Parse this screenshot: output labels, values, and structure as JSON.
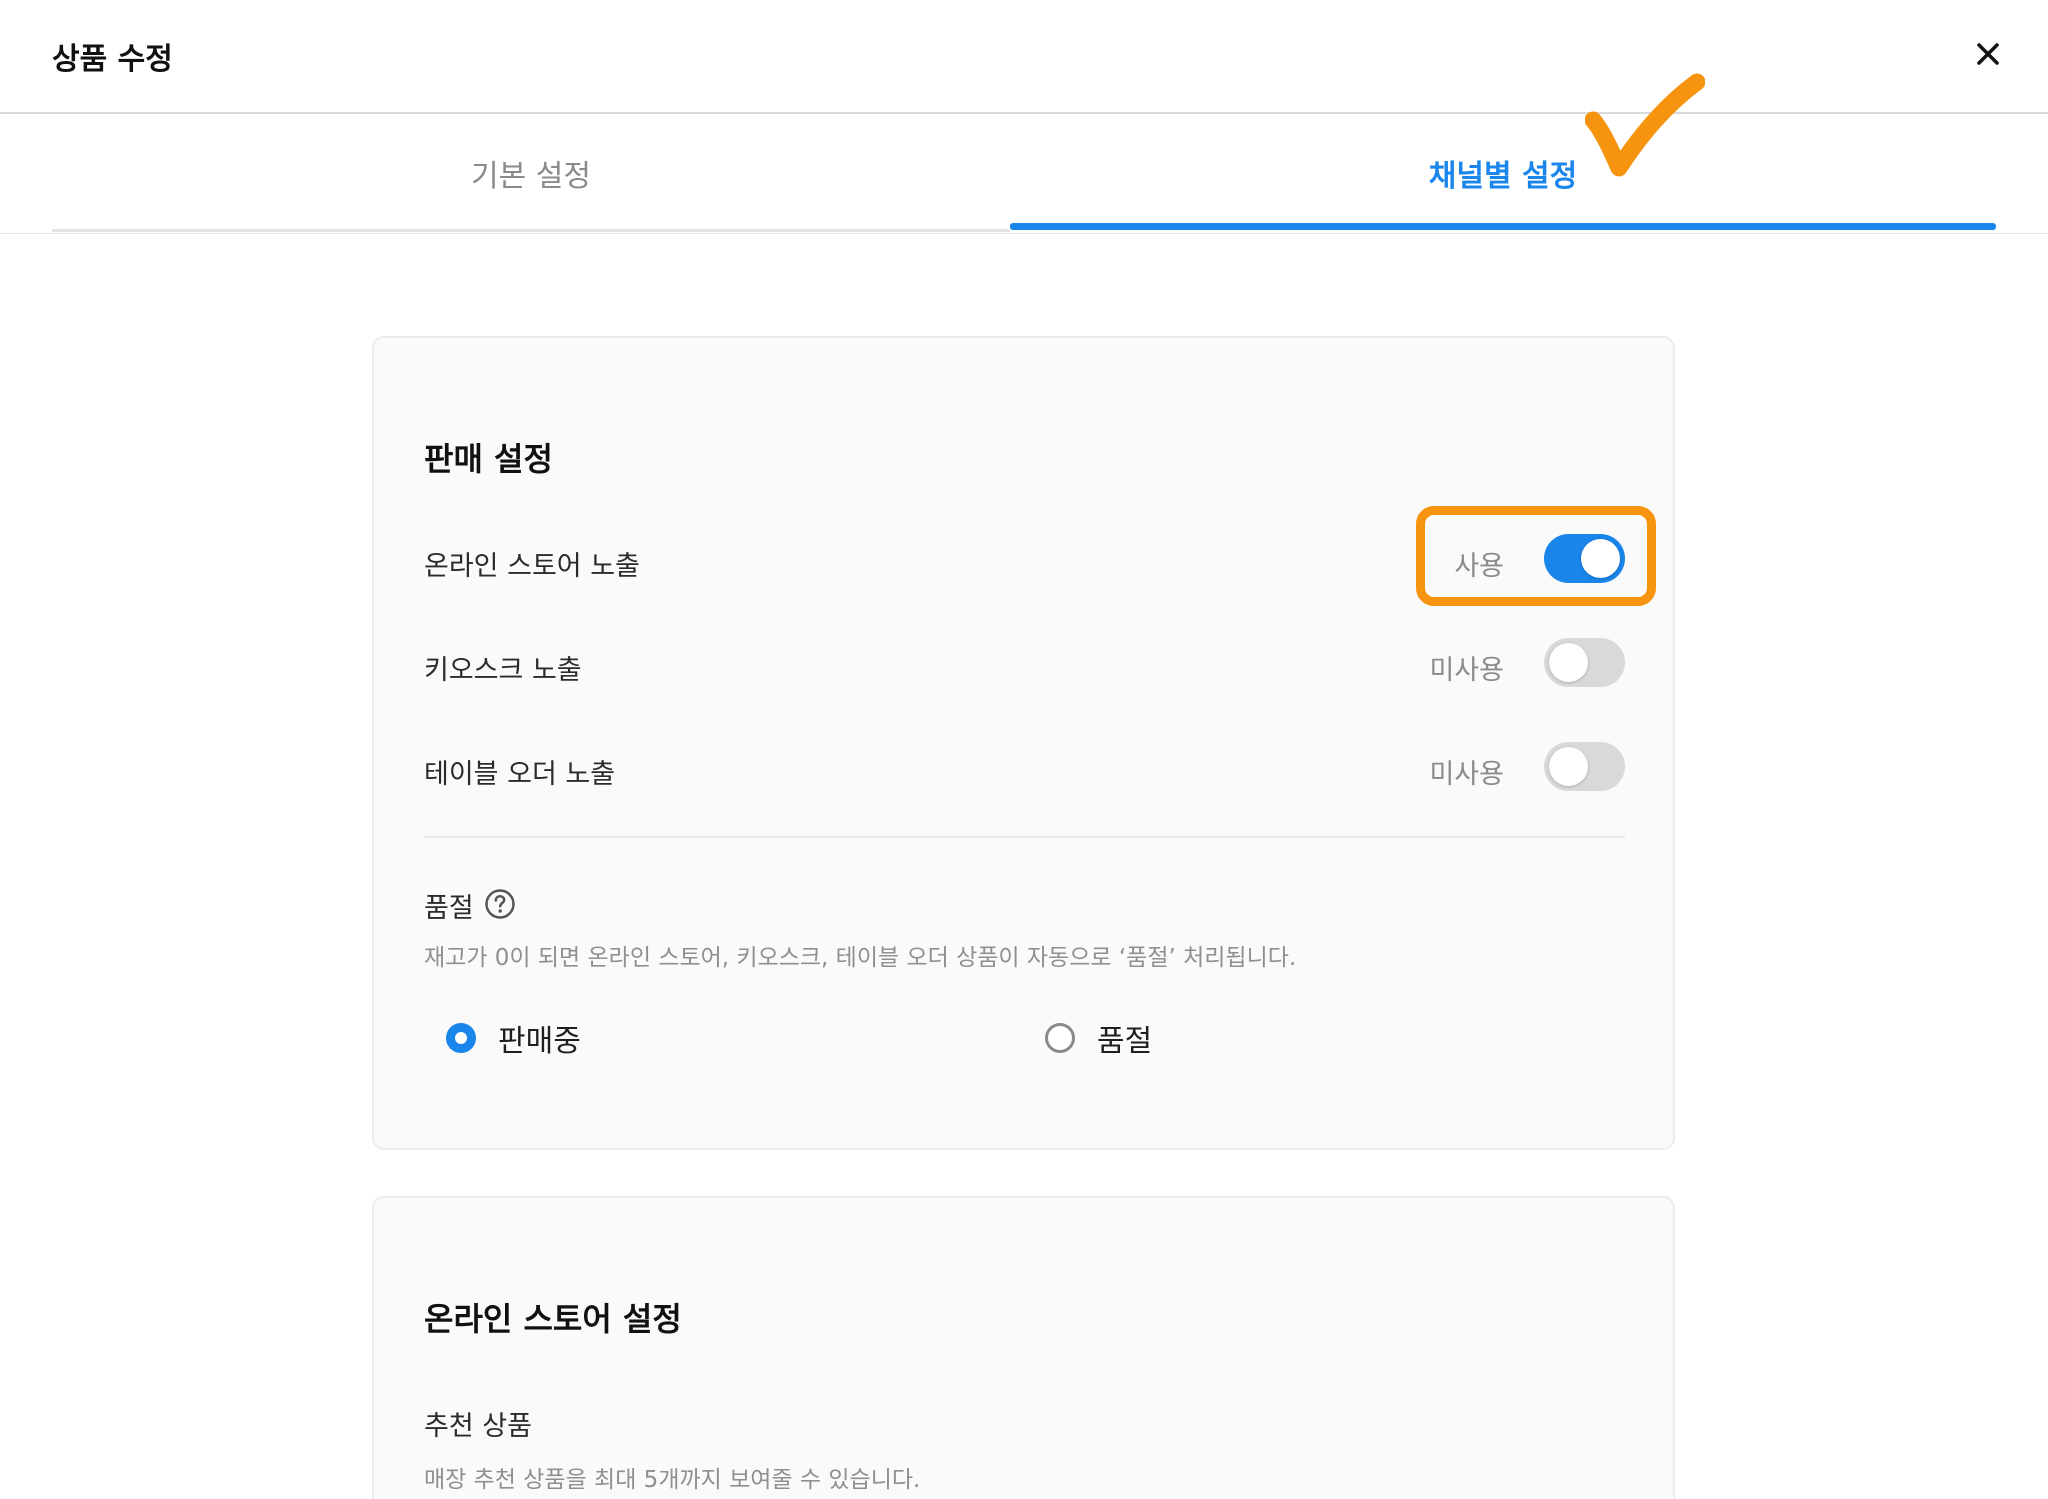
{
  "header": {
    "title": "상품 수정",
    "close_icon": "close-icon"
  },
  "tabs": [
    {
      "label": "기본 설정",
      "active": false
    },
    {
      "label": "채널별 설정",
      "active": true
    }
  ],
  "sales_settings": {
    "title": "판매 설정",
    "rows": [
      {
        "label": "온라인 스토어 노출",
        "status": "사용",
        "enabled": true
      },
      {
        "label": "키오스크 노출",
        "status": "미사용",
        "enabled": false
      },
      {
        "label": "테이블 오더 노출",
        "status": "미사용",
        "enabled": false
      }
    ],
    "soldout": {
      "label": "품절",
      "help_icon": "question-circle-icon",
      "description": "재고가 0이 되면 온라인 스토어, 키오스크, 테이블 오더 상품이 자동으로 ‘품절’ 처리됩니다.",
      "options": [
        {
          "label": "판매중",
          "selected": true
        },
        {
          "label": "품절",
          "selected": false
        }
      ]
    }
  },
  "online_store_settings": {
    "title": "온라인 스토어 설정",
    "recommended": {
      "label": "추천 상품",
      "description": "매장 추천 상품을 최대 5개까지 보여줄 수 있습니다."
    }
  },
  "colors": {
    "accent": "#1a85ea",
    "highlight": "#f7940f",
    "toggle_off": "#d9d9d9"
  },
  "annotations": {
    "checkmark_icon": "orange-checkmark-icon",
    "highlight": "orange-highlight-box"
  }
}
